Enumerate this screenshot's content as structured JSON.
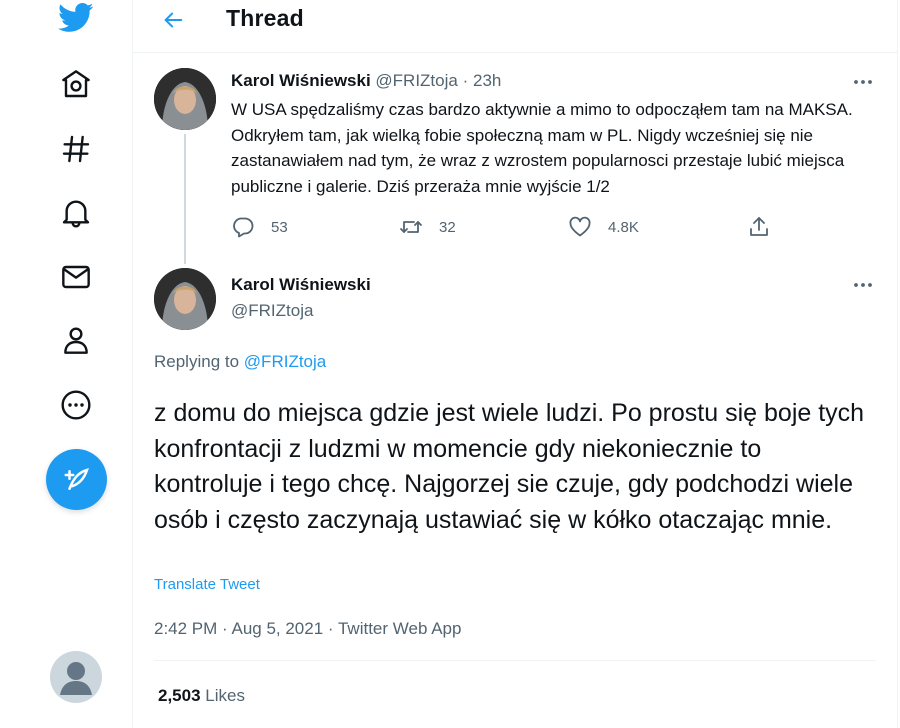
{
  "header": {
    "title": "Thread"
  },
  "nav": {
    "items": [
      "twitter-logo-icon",
      "home-icon",
      "explore-icon",
      "notifications-icon",
      "messages-icon",
      "profile-icon",
      "more-icon"
    ],
    "compose": "compose-tweet-icon",
    "accent": "#1d9bf0"
  },
  "tweet1": {
    "name": "Karol Wiśniewski",
    "handle": "@FRIZtoja",
    "separator": "·",
    "time": "23h",
    "text": "W USA spędzaliśmy czas bardzo aktywnie a mimo to odpocząłem tam na MAKSA. Odkryłem tam, jak wielką fobie społeczną mam w PL. Nigdy wcześniej się nie zastanawiałem nad tym, że wraz z wzrostem popularnosci przestaje lubić miejsca publiczne i galerie. Dziś przeraża mnie wyjście 1/2",
    "replies": "53",
    "retweets": "32",
    "likes": "4.8K"
  },
  "tweet2": {
    "name": "Karol Wiśniewski",
    "handle": "@FRIZtoja",
    "replying_label": "Replying to",
    "replying_to": "@FRIZtoja",
    "text": "z domu do miejsca gdzie jest wiele ludzi. Po prostu się boje tych konfrontacji z ludzmi w momencie gdy niekoniecznie to kontroluje i tego chcę. Najgorzej sie czuje, gdy podchodzi wiele osób i często zaczynają ustawiać się w kółko otaczając mnie.",
    "translate": "Translate Tweet",
    "timestamp": "2:42 PM · Aug 5, 2021 · Twitter Web App",
    "likes_count": "2,503",
    "likes_label": "Likes"
  }
}
